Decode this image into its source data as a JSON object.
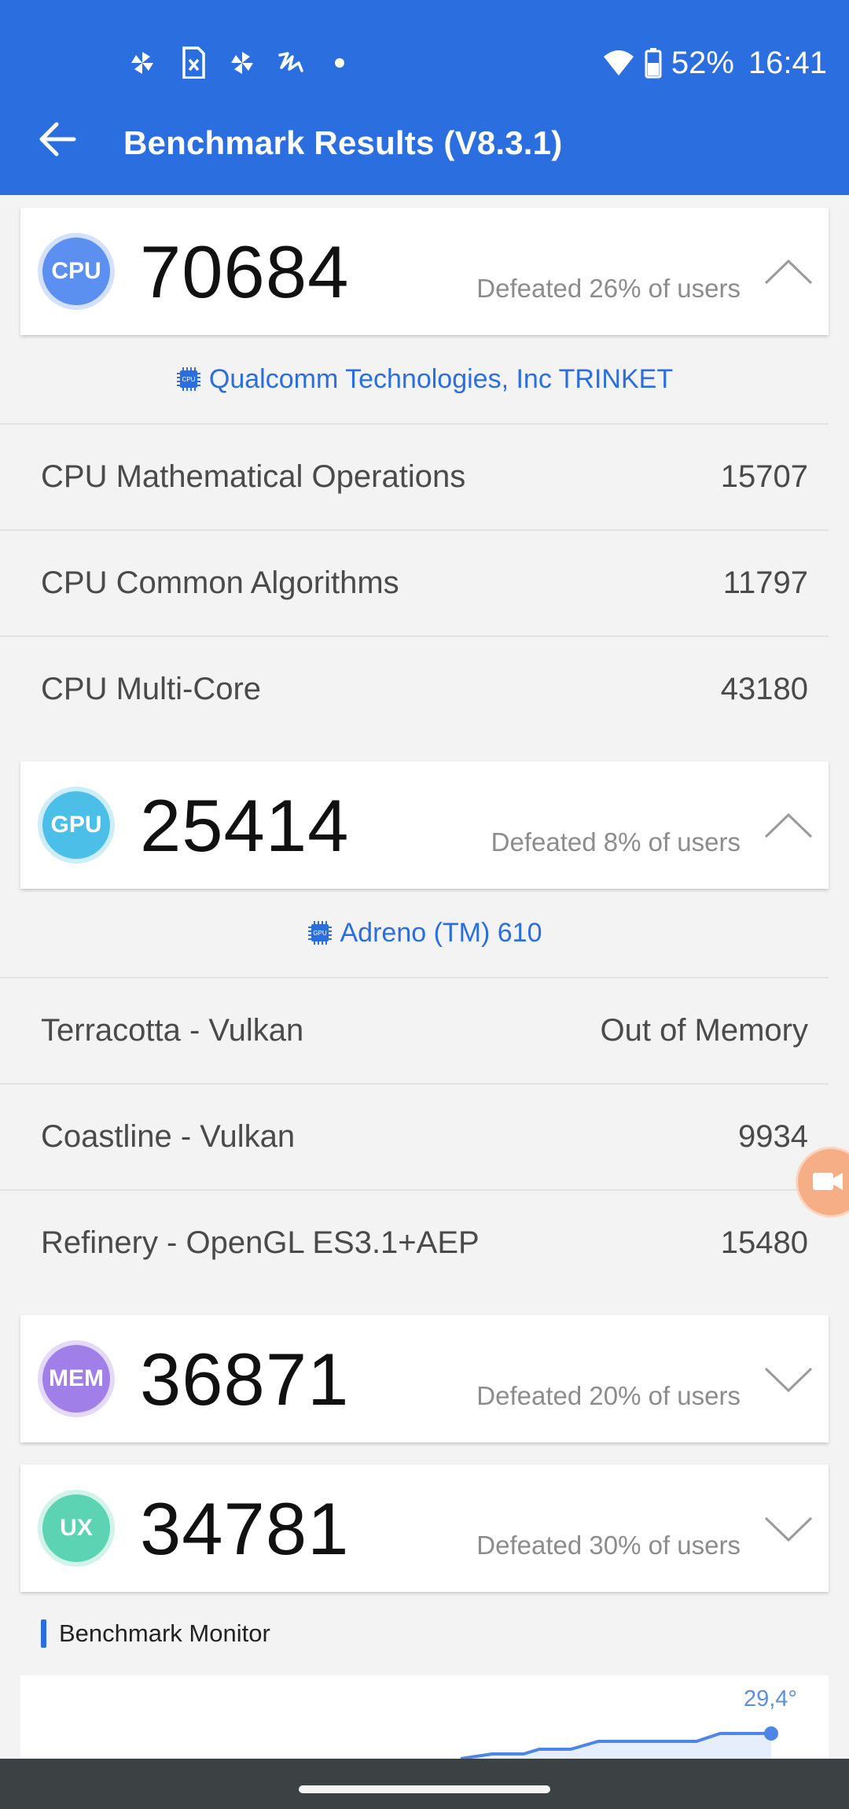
{
  "status_bar": {
    "battery": "52%",
    "time": "16:41",
    "icons": [
      "pinwheel-icon",
      "sim-card-icon",
      "pinwheel-icon",
      "scribble-icon",
      "dot-icon",
      "wifi-icon",
      "battery-icon"
    ]
  },
  "app_bar": {
    "title": "Benchmark Results (V8.3.1)"
  },
  "sections": {
    "cpu": {
      "badge": "CPU",
      "score": "70684",
      "defeated": "Defeated 26% of users",
      "vendor": "Qualcomm Technologies, Inc TRINKET",
      "vendor_icon_text": "CPU",
      "expanded": true,
      "rows": [
        {
          "label": "CPU Mathematical Operations",
          "value": "15707"
        },
        {
          "label": "CPU Common Algorithms",
          "value": "11797"
        },
        {
          "label": "CPU Multi-Core",
          "value": "43180"
        }
      ]
    },
    "gpu": {
      "badge": "GPU",
      "score": "25414",
      "defeated": "Defeated 8% of users",
      "vendor": "Adreno (TM) 610",
      "vendor_icon_text": "GPU",
      "expanded": true,
      "rows": [
        {
          "label": "Terracotta - Vulkan",
          "value": "Out of Memory"
        },
        {
          "label": "Coastline - Vulkan",
          "value": "9934"
        },
        {
          "label": "Refinery - OpenGL ES3.1+AEP",
          "value": "15480"
        }
      ]
    },
    "mem": {
      "badge": "MEM",
      "score": "36871",
      "defeated": "Defeated 20% of users",
      "expanded": false
    },
    "ux": {
      "badge": "UX",
      "score": "34781",
      "defeated": "Defeated 30% of users",
      "expanded": false
    }
  },
  "monitor": {
    "title": "Benchmark Monitor",
    "temperature": "29,4°"
  },
  "colors": {
    "primary": "#2b6ee0",
    "cpu": "#5b8ff0",
    "gpu": "#4bbfe8",
    "mem": "#a07fe8",
    "ux": "#5cd3b2",
    "background": "#f4f3f4"
  }
}
